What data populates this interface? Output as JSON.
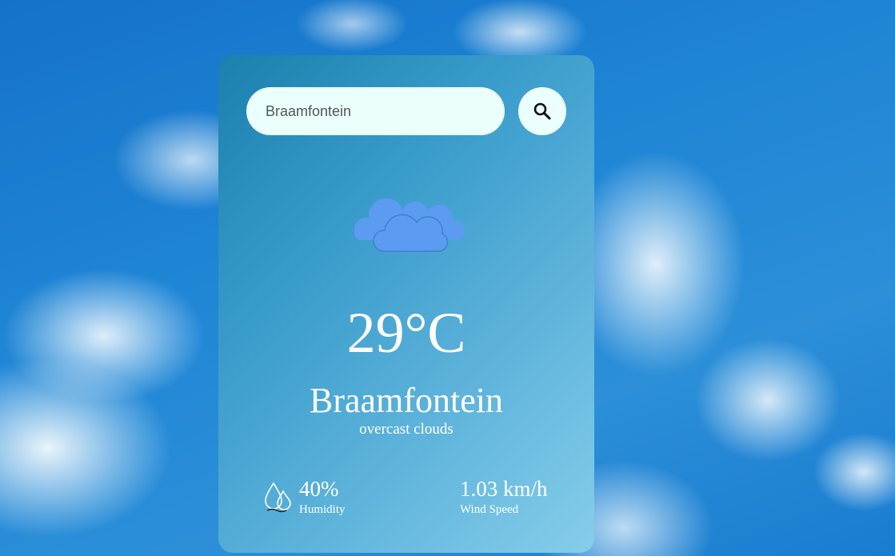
{
  "search": {
    "value": "Braamfontein",
    "icon": "search-icon"
  },
  "weather": {
    "icon": "clouds-icon",
    "temperature": "29°C",
    "city": "Braamfontein",
    "description": "overcast clouds"
  },
  "humidity": {
    "icon": "humidity-icon",
    "value": "40%",
    "label": "Humidity"
  },
  "wind": {
    "value": "1.03 km/h",
    "label": "Wind Speed"
  },
  "colors": {
    "input_background": "#ebfffc",
    "cloud_icon": "#5b9cf0",
    "text": "#ffffff"
  }
}
